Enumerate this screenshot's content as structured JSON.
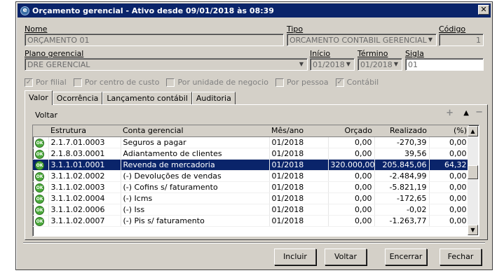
{
  "window": {
    "title": "Orçamento gerencial - Ativo desde 09/01/2018 às 08:39",
    "close_glyph": "✕",
    "icon_glyph": "e"
  },
  "form": {
    "nome_label": "Nome",
    "nome_value": "ORÇAMENTO 01",
    "tipo_label": "Tipo",
    "tipo_value": "ORCAMENTO CONTABIL GERENCIAL",
    "codigo_label": "Código",
    "codigo_value": "1",
    "plano_label": "Plano gerencial",
    "plano_value": "DRE GERENCIAL",
    "inicio_label": "Início",
    "inicio_value": "01/2018",
    "termino_label": "Término",
    "termino_value": "01/2018",
    "sigla_label": "Sigla",
    "sigla_value": "01"
  },
  "checkboxes": [
    {
      "label": "Por filial",
      "checked": true
    },
    {
      "label": "Por centro de custo",
      "checked": false
    },
    {
      "label": "Por unidade de negocio",
      "checked": false
    },
    {
      "label": "Por pessoa",
      "checked": false
    },
    {
      "label": "Contábil",
      "checked": true
    }
  ],
  "tabs": [
    "Valor",
    "Ocorrência",
    "Lançamento contábil",
    "Auditoria"
  ],
  "panel": {
    "voltar_label": "Voltar",
    "plus": "+",
    "up": "▲",
    "minus": "−"
  },
  "grid": {
    "status_glyph": "OK",
    "headers": [
      "Estrutura",
      "Conta gerencial",
      "Mês/ano",
      "Orçado",
      "Realizado",
      "(%)"
    ],
    "rows": [
      [
        "2.1.7.01.0003",
        "Seguros a pagar",
        "01/2018",
        "0,00",
        "-270,39",
        "0,00"
      ],
      [
        "2.1.8.03.0001",
        "Adiantamento de clientes",
        "01/2018",
        "0,00",
        "39,56",
        "0,00"
      ],
      [
        "3.1.1.01.0001",
        "Revenda de mercadoria",
        "01/2018",
        "320.000,00",
        "205.845,06",
        "64,32"
      ],
      [
        "3.1.1.02.0002",
        "(-) Devoluções de vendas",
        "01/2018",
        "0,00",
        "-2.484,99",
        "0,00"
      ],
      [
        "3.1.1.02.0003",
        "(-) Cofins s/ faturamento",
        "01/2018",
        "0,00",
        "-5.821,19",
        "0,00"
      ],
      [
        "3.1.1.02.0004",
        "(-) Icms",
        "01/2018",
        "0,00",
        "-172,65",
        "0,00"
      ],
      [
        "3.1.1.02.0006",
        "(-) Iss",
        "01/2018",
        "0,00",
        "-0,02",
        "0,00"
      ],
      [
        "3.1.1.02.0007",
        "(-) Pis s/ faturamento",
        "01/2018",
        "0,00",
        "-1.263,77",
        "0,00"
      ]
    ],
    "selected_row": 2
  },
  "buttons": {
    "incluir": "Incluir",
    "voltar": "Voltar",
    "encerrar": "Encerrar",
    "fechar": "Fechar"
  },
  "colors": {
    "title_bar": "#0a246a",
    "selection": "#0a246a",
    "ok_icon": "#4caa3c",
    "face": "#d4d0c8"
  }
}
